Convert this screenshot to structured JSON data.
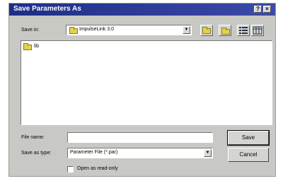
{
  "window": {
    "title": "Save Parameters As",
    "help_glyph": "?",
    "close_glyph": "×"
  },
  "toolbar": {
    "save_in_label": "Save in:",
    "save_in_value": "ImpulseLink 3.0",
    "dropdown_glyph": "▼"
  },
  "file_list": {
    "items": [
      {
        "name": "lib",
        "icon": "folder-icon"
      }
    ]
  },
  "form": {
    "file_name_label": "File name:",
    "file_name_value": "",
    "save_type_label": "Save as type:",
    "save_type_value": "Parameter File (*.par)",
    "readonly_label": "Open as read-only",
    "readonly_checked": false
  },
  "buttons": {
    "save_label": "Save",
    "cancel_label": "Cancel"
  }
}
